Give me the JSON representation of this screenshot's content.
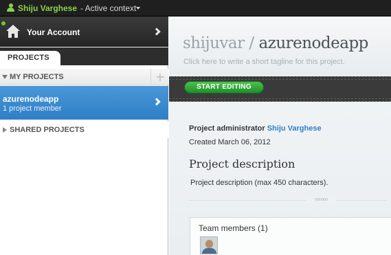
{
  "topbar": {
    "username": "Shiju Varghese",
    "context": "- Active context"
  },
  "sidebar": {
    "account_label": "Your Account",
    "tab_label": "PROJECTS",
    "my_projects_label": "MY PROJECTS",
    "shared_projects_label": "SHARED PROJECTS",
    "project": {
      "name": "azurenodeapp",
      "members": "1 project member"
    }
  },
  "main": {
    "owner": "shijuvar",
    "separator": " / ",
    "project_name": "azurenodeapp",
    "tagline": "Click here to write a short tagline for this project.",
    "start_editing": "START EDITING",
    "admin_label": "Project administrator",
    "admin_name": "Shiju Varghese",
    "created": "Created March 06, 2012",
    "description_heading": "Project description",
    "description_text": "Project description (max 450 characters).",
    "team_title": "Team members (1)"
  },
  "colors": {
    "topbar_bg": "#1f1f1f",
    "username_green": "#8bd14a",
    "selected_blue": "#2f7fc6",
    "button_green": "#2ea33a"
  }
}
